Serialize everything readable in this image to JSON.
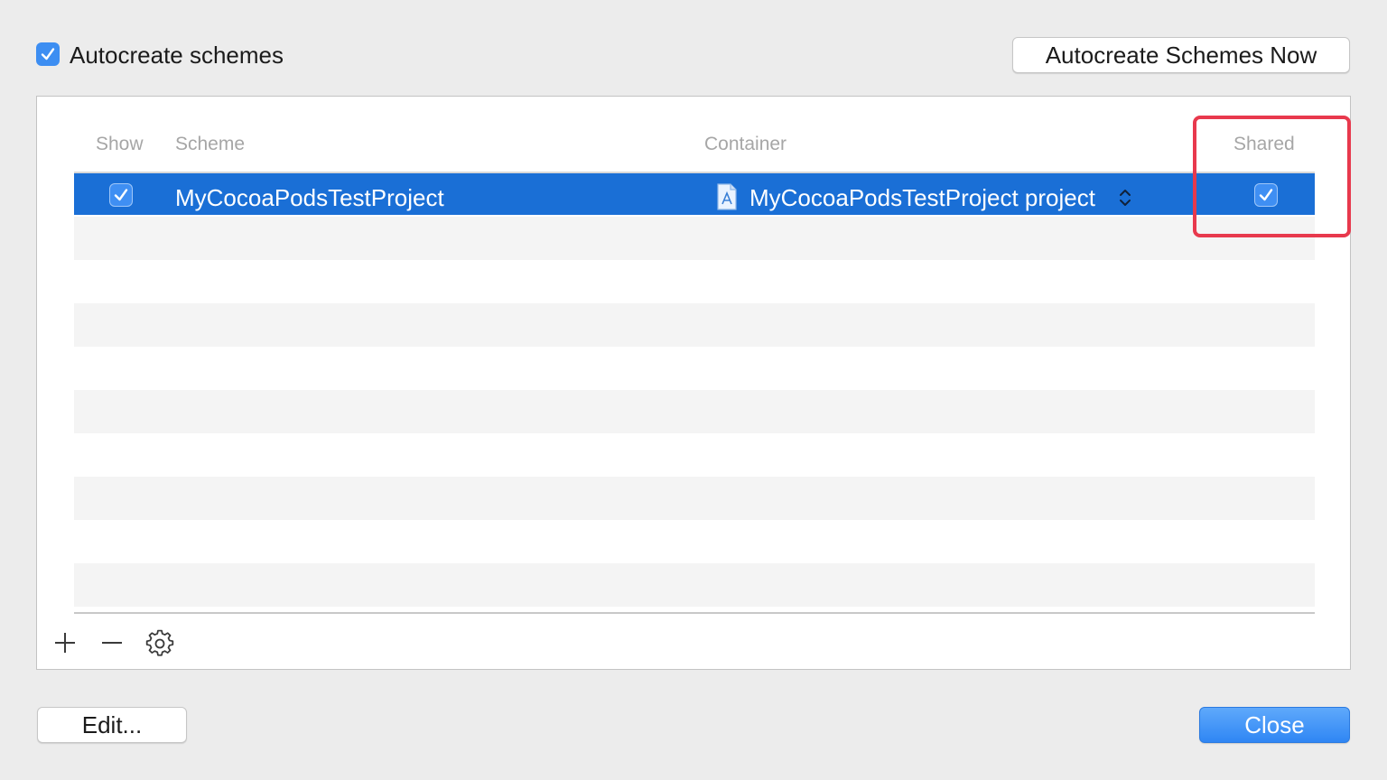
{
  "top": {
    "autocreate_label": "Autocreate schemes",
    "autocreate_checked": true,
    "autocreate_now_button": "Autocreate Schemes Now"
  },
  "table": {
    "columns": {
      "show": "Show",
      "scheme": "Scheme",
      "container": "Container",
      "shared": "Shared"
    },
    "rows": [
      {
        "show": true,
        "scheme": "MyCocoaPodsTestProject",
        "container": "MyCocoaPodsTestProject project",
        "shared": true,
        "selected": true
      }
    ]
  },
  "toolbar": {
    "add_icon": "plus-icon",
    "remove_icon": "minus-icon",
    "settings_icon": "gear-icon"
  },
  "footer": {
    "edit_button": "Edit...",
    "close_button": "Close"
  },
  "colors": {
    "selection": "#1a6fd6",
    "checkbox": "#3d8ef2",
    "highlight": "#e8394d",
    "primary_button": "#2f86f4"
  }
}
